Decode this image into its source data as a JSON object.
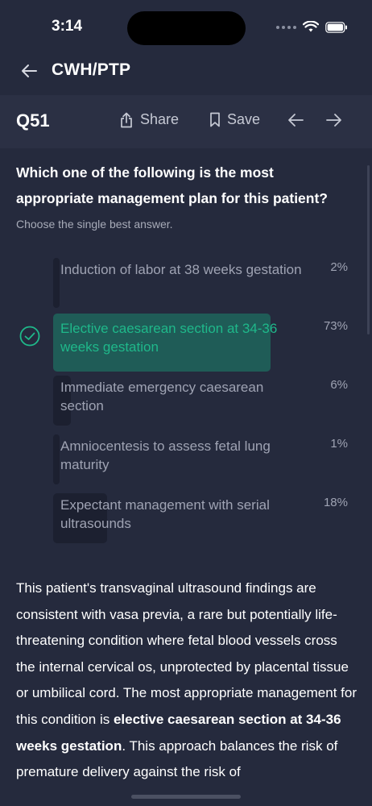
{
  "status": {
    "time": "3:14"
  },
  "nav": {
    "title": "CWH/PTP"
  },
  "toolbar": {
    "question_number": "Q51",
    "share_label": "Share",
    "save_label": "Save"
  },
  "question": {
    "text": "Which one of the following is the most appropriate management plan for this patient?",
    "instruction": "Choose the single best answer."
  },
  "options": [
    {
      "label": "Induction of labor at 38 weeks gestation",
      "percent": "2%",
      "share": 0.02,
      "correct": false
    },
    {
      "label": "Elective caesarean section at 34-36 weeks gestation",
      "percent": "73%",
      "share": 0.73,
      "correct": true
    },
    {
      "label": "Immediate emergency caesarean section",
      "percent": "6%",
      "share": 0.06,
      "correct": false
    },
    {
      "label": "Amniocentesis to assess fetal lung maturity",
      "percent": "1%",
      "share": 0.01,
      "correct": false
    },
    {
      "label": "Expectant management with serial ultrasounds",
      "percent": "18%",
      "share": 0.18,
      "correct": false
    }
  ],
  "explanation": {
    "part1": "This patient's transvaginal ultrasound findings are consistent with vasa previa, a rare but potentially life-threatening condition where fetal blood vessels cross the internal cervical os, unprotected by placental tissue or umbilical cord. The most appropriate management for this condition is ",
    "bold": "elective caesarean section at 34-36 weeks gestation",
    "part2": ". This approach balances the risk of premature delivery against the risk of"
  },
  "colors": {
    "correct": "#1fb88a",
    "correct_bg": "#1f5c57",
    "bar": "#1c2030"
  },
  "icons": [
    "back-arrow-icon",
    "share-icon",
    "bookmark-icon",
    "arrow-left-icon",
    "arrow-right-icon",
    "check-circle-icon",
    "wifi-icon",
    "battery-icon"
  ]
}
